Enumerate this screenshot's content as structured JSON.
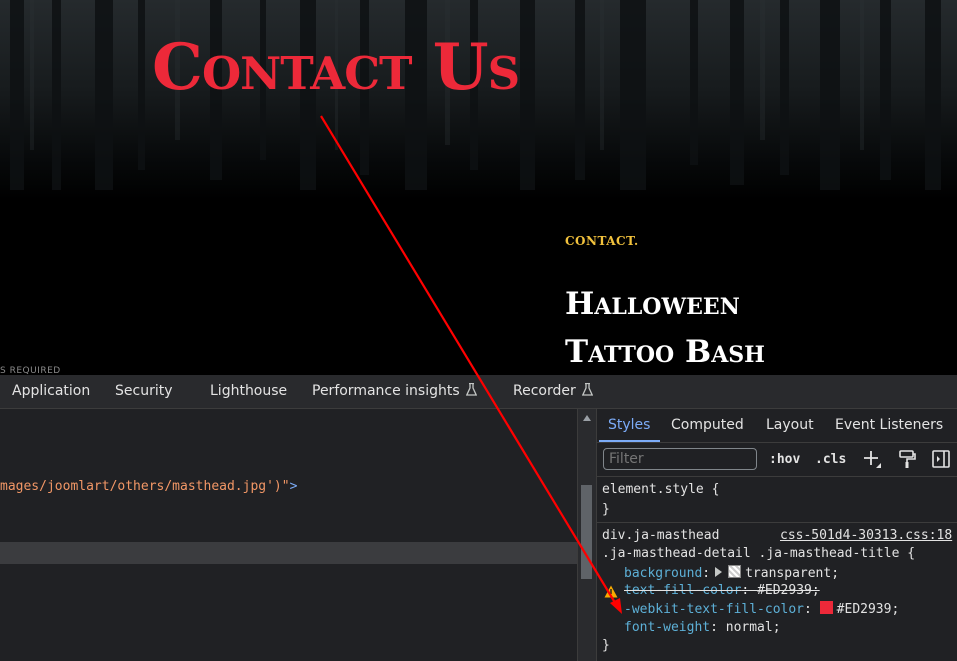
{
  "site": {
    "title": "Contact Us",
    "breadcrumb": "CONTACT.",
    "event_line1": "Halloween",
    "event_line2": "Tattoo Bash",
    "cut_text": "S REQUIRED",
    "title_color": "#ED2939",
    "breadcrumb_color": "#f2c23d"
  },
  "devtools": {
    "tabs": [
      "Application",
      "Security",
      "Lighthouse",
      "Performance insights",
      "Recorder"
    ],
    "experimental_icon": "flask-icon",
    "elements_panel": {
      "code_string": "mages/joomlart/others/masthead.jpg')\"",
      "code_tag_end": ">"
    },
    "sidebar": {
      "tabs": [
        "Styles",
        "Computed",
        "Layout",
        "Event Listeners"
      ],
      "active_tab": "Styles",
      "filter_placeholder": "Filter",
      "hov_label": ":hov",
      "cls_label": ".cls",
      "element_style": {
        "selector": "element.style {",
        "close": "}"
      },
      "rule": {
        "selector_line1": "div.ja-masthead",
        "source": "css-501d4-30313.css:18",
        "selector_line2": ".ja-masthead-detail .ja-masthead-title {",
        "background_prop": "background",
        "background_value": "transparent;",
        "tfc_prop": "text-fill-color",
        "tfc_value": "#ED2939;",
        "wtfc_prop": "-webkit-text-fill-color",
        "wtfc_value": "#ED2939;",
        "fw_prop": "font-weight",
        "fw_value": "normal;",
        "close": "}"
      },
      "swatch_color": "#ED2939"
    }
  },
  "annotation": {
    "arrow_color": "#ff0000"
  }
}
